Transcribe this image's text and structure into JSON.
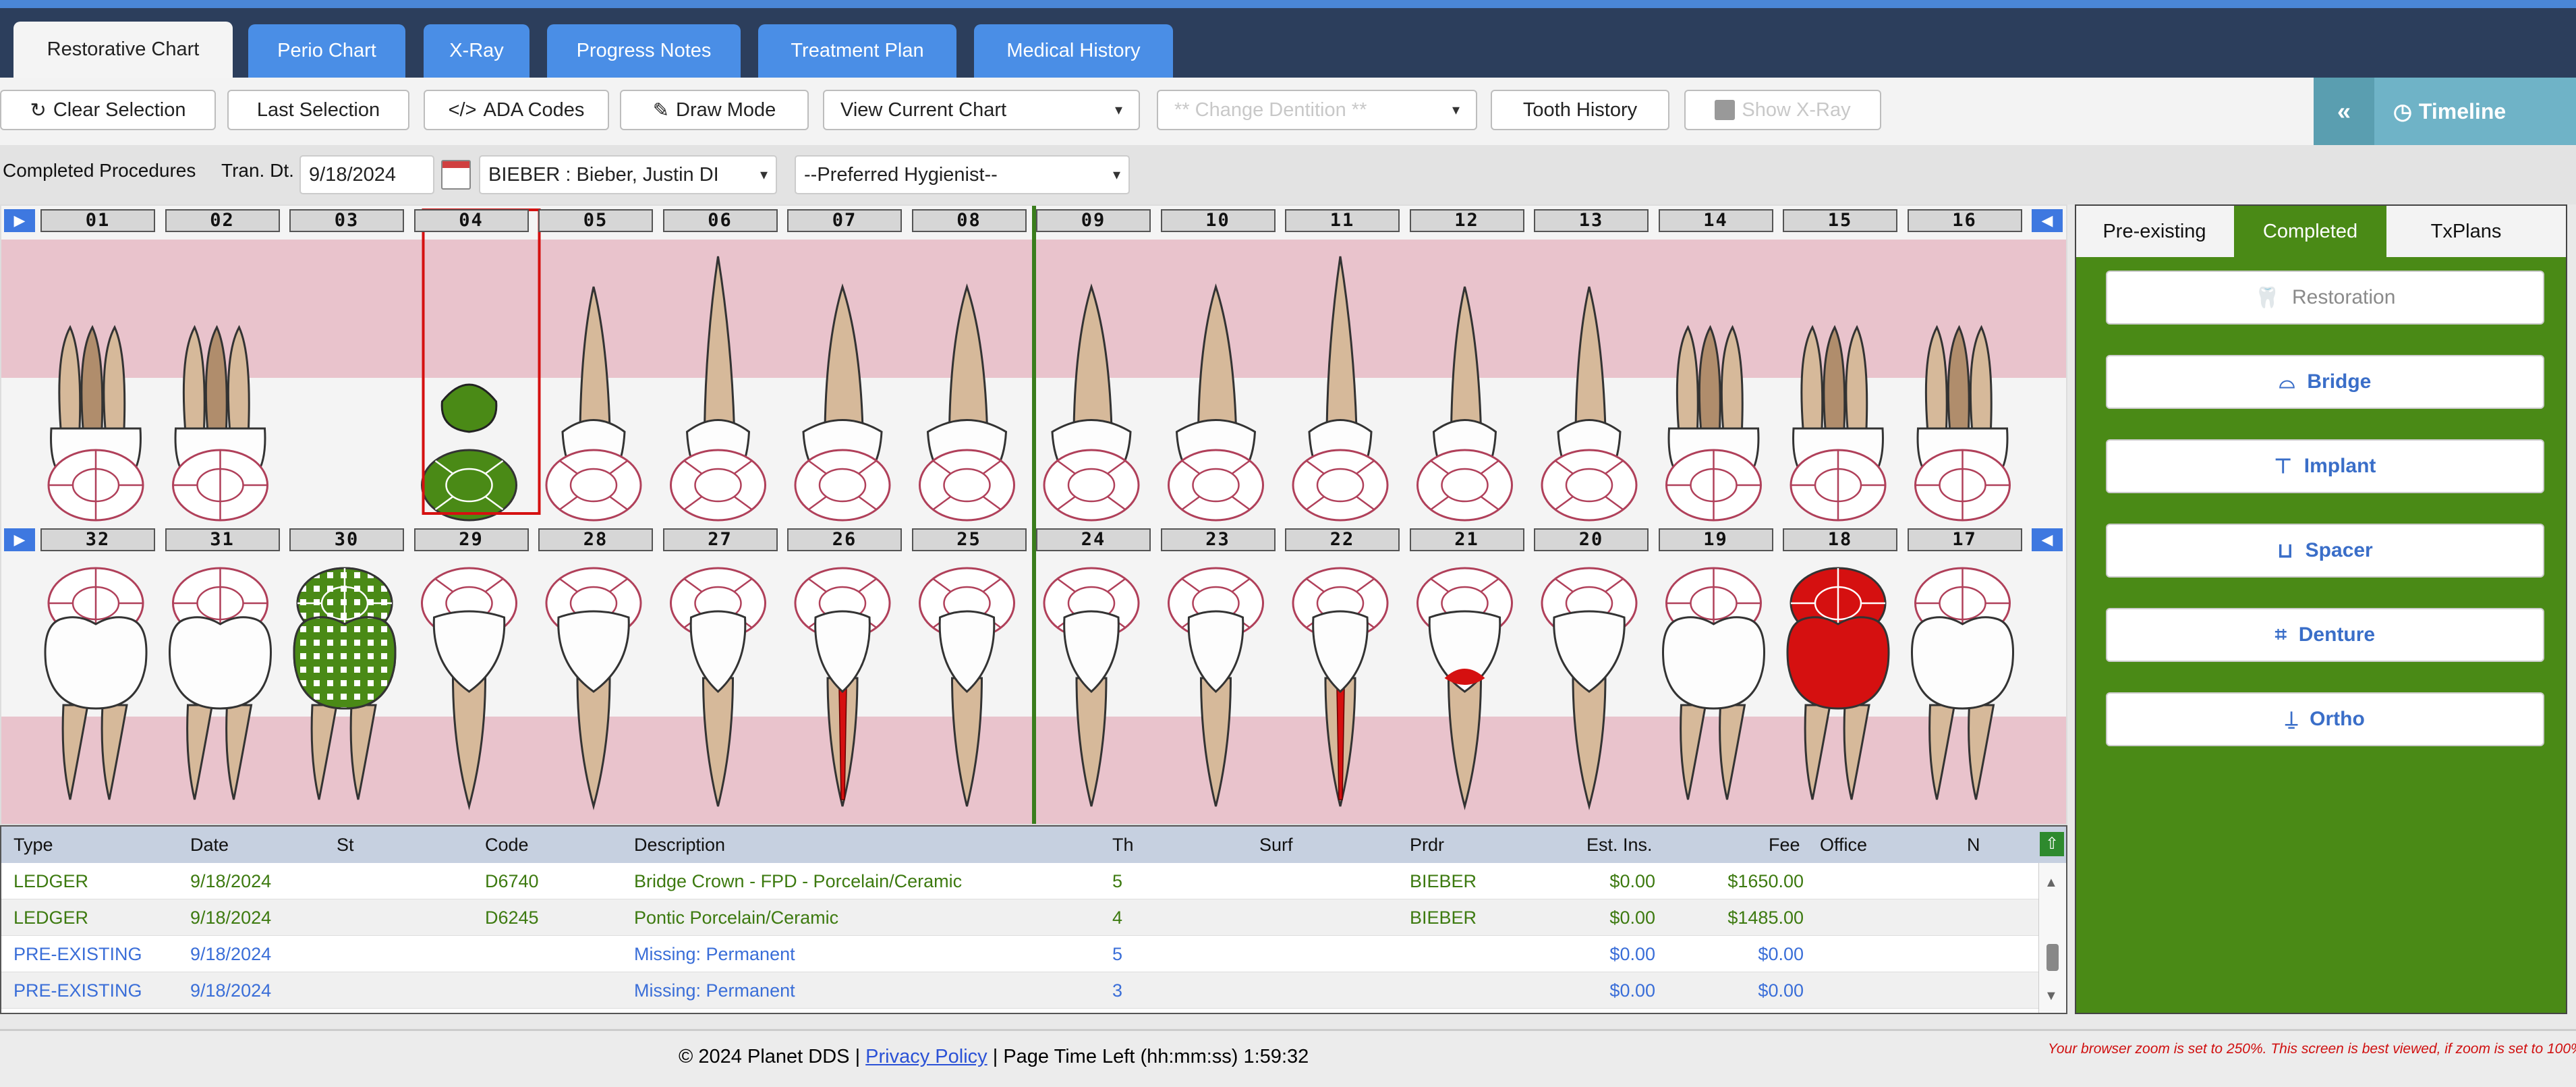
{
  "tabs": [
    "Restorative Chart",
    "Perio Chart",
    "X-Ray",
    "Progress Notes",
    "Treatment Plan",
    "Medical History"
  ],
  "toolbar": {
    "clear_selection": "Clear Selection",
    "last_selection": "Last Selection",
    "ada_codes": "ADA Codes",
    "draw_mode": "Draw Mode",
    "view_chart": "View Current Chart",
    "change_dentition": "** Change Dentition **",
    "tooth_history": "Tooth History",
    "show_xray": "Show X-Ray",
    "timeline": "Timeline"
  },
  "filter": {
    "completed_label": "Completed Procedures",
    "tran_label": "Tran. Dt.",
    "tran_date": "9/18/2024",
    "provider": "BIEBER : Bieber, Justin DI",
    "hygienist": "--Preferred Hygienist--"
  },
  "upper_teeth": [
    "01",
    "02",
    "03",
    "04",
    "05",
    "06",
    "07",
    "08",
    "09",
    "10",
    "11",
    "12",
    "13",
    "14",
    "15",
    "16"
  ],
  "lower_teeth": [
    "32",
    "31",
    "30",
    "29",
    "28",
    "27",
    "26",
    "25",
    "24",
    "23",
    "22",
    "21",
    "20",
    "19",
    "18",
    "17"
  ],
  "upper_molar_flags": [
    true,
    true,
    false,
    false,
    false,
    false,
    false,
    false,
    false,
    false,
    false,
    false,
    false,
    true,
    true,
    true
  ],
  "lower_molar_flags": [
    true,
    true,
    true,
    false,
    false,
    false,
    false,
    false,
    false,
    false,
    false,
    false,
    false,
    true,
    true,
    true
  ],
  "right_panel": {
    "tabs": [
      "Pre-existing",
      "Completed",
      "TxPlans"
    ],
    "buttons": [
      "Restoration",
      "Bridge",
      "Implant",
      "Spacer",
      "Denture",
      "Ortho"
    ]
  },
  "grid": {
    "headers": [
      "Type",
      "Date",
      "St",
      "Code",
      "Description",
      "Th",
      "Surf",
      "Prdr",
      "Est. Ins.",
      "Fee",
      "Office",
      "N"
    ],
    "rows": [
      {
        "type": "LEDGER",
        "date": "9/18/2024",
        "st": "",
        "code": "D6740",
        "desc": "Bridge Crown - FPD - Porcelain/Ceramic",
        "th": "5",
        "surf": "",
        "prdr": "BIEBER",
        "ins": "$0.00",
        "fee": "$1650.00",
        "color": "#3d7a10"
      },
      {
        "type": "LEDGER",
        "date": "9/18/2024",
        "st": "",
        "code": "D6245",
        "desc": "Pontic Porcelain/Ceramic",
        "th": "4",
        "surf": "",
        "prdr": "BIEBER",
        "ins": "$0.00",
        "fee": "$1485.00",
        "color": "#3d7a10"
      },
      {
        "type": "PRE-EXISTING",
        "date": "9/18/2024",
        "st": "",
        "code": "",
        "desc": "Missing: Permanent",
        "th": "5",
        "surf": "",
        "prdr": "",
        "ins": "$0.00",
        "fee": "$0.00",
        "color": "#3a6ed8"
      },
      {
        "type": "PRE-EXISTING",
        "date": "9/18/2024",
        "st": "",
        "code": "",
        "desc": "Missing: Permanent",
        "th": "3",
        "surf": "",
        "prdr": "",
        "ins": "$0.00",
        "fee": "$0.00",
        "color": "#3a6ed8"
      }
    ]
  },
  "footer": {
    "copyright": "© 2024 Planet DDS |",
    "privacy": "Privacy Policy",
    "timer": "|  Page Time Left (hh:mm:ss) 1:59:32",
    "warning": "Your browser zoom is set to 250%. This screen is best viewed, if zoom is set to 100%."
  },
  "colors": {
    "accent": "#4a8ee6",
    "green": "#4a8a16",
    "red": "#d51010",
    "gum": "#e9c3cc"
  }
}
